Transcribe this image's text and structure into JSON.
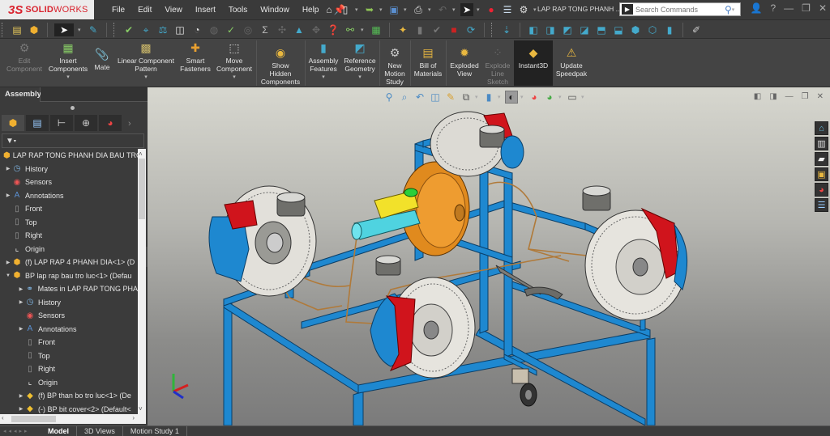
{
  "app": {
    "brand_prefix": "3S",
    "brand_bold": "SOLID",
    "brand_light": "WORKS",
    "document_title": "LAP RAP TONG PHANH ...",
    "menu": [
      "File",
      "Edit",
      "View",
      "Insert",
      "Tools",
      "Window",
      "Help"
    ],
    "search": {
      "placeholder": "Search Commands",
      "value": ""
    },
    "window_controls": [
      "minimize",
      "restore",
      "close"
    ]
  },
  "quick_access": [
    "home-icon",
    "new-document-icon",
    "open-icon",
    "save-icon",
    "print-icon",
    "undo-icon",
    "select-icon",
    "rebuild-traffic-light-icon",
    "file-properties-icon",
    "options-gear-icon"
  ],
  "command_manager": {
    "buttons": [
      {
        "label": "Edit Component",
        "lines": [
          "Edit",
          "Component"
        ],
        "enabled": false,
        "dropdown": false
      },
      {
        "label": "Insert Components",
        "lines": [
          "Insert",
          "Components"
        ],
        "enabled": true,
        "dropdown": true
      },
      {
        "label": "Mate",
        "lines": [
          "Mate"
        ],
        "enabled": true,
        "dropdown": false
      },
      {
        "label": "Linear Component Pattern",
        "lines": [
          "Linear Component",
          "Pattern"
        ],
        "enabled": true,
        "dropdown": true
      },
      {
        "label": "Smart Fasteners",
        "lines": [
          "Smart",
          "Fasteners"
        ],
        "enabled": true,
        "dropdown": false
      },
      {
        "label": "Move Component",
        "lines": [
          "Move",
          "Component"
        ],
        "enabled": true,
        "dropdown": true
      },
      {
        "label": "Show Hidden Components",
        "lines": [
          "Show",
          "Hidden",
          "Components"
        ],
        "enabled": true,
        "dropdown": false
      },
      {
        "label": "Assembly Features",
        "lines": [
          "Assembly",
          "Features"
        ],
        "enabled": true,
        "dropdown": true
      },
      {
        "label": "Reference Geometry",
        "lines": [
          "Reference",
          "Geometry"
        ],
        "enabled": true,
        "dropdown": true
      },
      {
        "label": "New Motion Study",
        "lines": [
          "New",
          "Motion",
          "Study"
        ],
        "enabled": true,
        "dropdown": false
      },
      {
        "label": "Bill of Materials",
        "lines": [
          "Bill of",
          "Materials"
        ],
        "enabled": true,
        "dropdown": false
      },
      {
        "label": "Exploded View",
        "lines": [
          "Exploded",
          "View"
        ],
        "enabled": true,
        "dropdown": false
      },
      {
        "label": "Explode Line Sketch",
        "lines": [
          "Explode",
          "Line",
          "Sketch"
        ],
        "enabled": false,
        "dropdown": false
      },
      {
        "label": "Instant3D",
        "lines": [
          "Instant3D"
        ],
        "enabled": true,
        "dropdown": false,
        "active": true
      },
      {
        "label": "Update Speedpak",
        "lines": [
          "Update",
          "Speedpak"
        ],
        "enabled": true,
        "dropdown": false
      }
    ]
  },
  "left_panel": {
    "tab": "Assembly",
    "feature_tree": [
      {
        "label": "LAP RAP TONG PHANH DIA BAU TRO",
        "level": 0,
        "icon": "assembly-icon",
        "expander": ""
      },
      {
        "label": "History",
        "level": 1,
        "icon": "history-folder-icon",
        "expander": "collapsed"
      },
      {
        "label": "Sensors",
        "level": 1,
        "icon": "sensors-folder-icon",
        "expander": ""
      },
      {
        "label": "Annotations",
        "level": 1,
        "icon": "annotations-folder-icon",
        "expander": "collapsed"
      },
      {
        "label": "Front",
        "level": 1,
        "icon": "plane-icon",
        "expander": ""
      },
      {
        "label": "Top",
        "level": 1,
        "icon": "plane-icon",
        "expander": ""
      },
      {
        "label": "Right",
        "level": 1,
        "icon": "plane-icon",
        "expander": ""
      },
      {
        "label": "Origin",
        "level": 1,
        "icon": "origin-icon",
        "expander": ""
      },
      {
        "label": "(f) LAP RAP 4 PHANH DIA<1> (D",
        "level": 1,
        "icon": "subassembly-icon",
        "expander": "collapsed"
      },
      {
        "label": "BP lap rap bau tro luc<1> (Defau",
        "level": 1,
        "icon": "subassembly-icon",
        "expander": "expanded"
      },
      {
        "label": "Mates in LAP RAP TONG PHA",
        "level": 2,
        "icon": "mates-folder-icon",
        "expander": "collapsed"
      },
      {
        "label": "History",
        "level": 2,
        "icon": "history-folder-icon",
        "expander": "collapsed"
      },
      {
        "label": "Sensors",
        "level": 2,
        "icon": "sensors-folder-icon",
        "expander": ""
      },
      {
        "label": "Annotations",
        "level": 2,
        "icon": "annotations-folder-icon",
        "expander": "collapsed"
      },
      {
        "label": "Front",
        "level": 2,
        "icon": "plane-icon",
        "expander": ""
      },
      {
        "label": "Top",
        "level": 2,
        "icon": "plane-icon",
        "expander": ""
      },
      {
        "label": "Right",
        "level": 2,
        "icon": "plane-icon",
        "expander": ""
      },
      {
        "label": "Origin",
        "level": 2,
        "icon": "origin-icon",
        "expander": ""
      },
      {
        "label": "(f) BP than bo tro luc<1> (De",
        "level": 2,
        "icon": "part-icon",
        "expander": "collapsed"
      },
      {
        "label": "(-) BP bit cover<2> (Default<",
        "level": 2,
        "icon": "part-icon",
        "expander": "collapsed"
      }
    ]
  },
  "bottom_tabs": [
    {
      "label": "Model",
      "selected": true
    },
    {
      "label": "3D Views",
      "selected": false
    },
    {
      "label": "Motion Study 1",
      "selected": false
    }
  ],
  "viewport": {
    "model_description": "Brake system training rig: blue tubular frame, four disc brakes with red calipers, orange vacuum booster with yellow master cylinder reservoir, copper brake lines, pedal and caster wheel",
    "triad_axes": [
      "X",
      "Y",
      "Z"
    ],
    "colors": {
      "frame": "#1e88d0",
      "caliper": "#d0141c",
      "booster": "#e08a1e",
      "reservoir": "#f2e12a",
      "master_cylinder": "#4fd3e0",
      "disc": "#e8e6e0",
      "brake_line": "#b07a3a"
    }
  }
}
